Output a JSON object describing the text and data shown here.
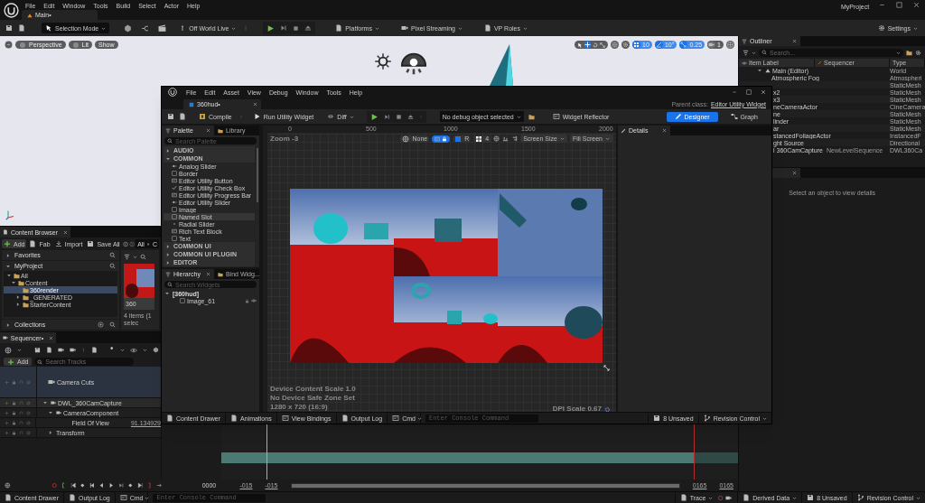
{
  "app_menu": [
    "File",
    "Edit",
    "Window",
    "Tools",
    "Build",
    "Select",
    "Actor",
    "Help"
  ],
  "level_tab": "Main•",
  "project_name": "MyProject",
  "toolbar": {
    "mode": "Selection Mode",
    "world": "Off World Live",
    "platforms": "Platforms",
    "pixel_streaming": "Pixel Streaming",
    "vp_roles": "VP Roles",
    "settings": "Settings"
  },
  "viewport": {
    "pills": [
      "Perspective",
      "Lit",
      "Show"
    ],
    "snap": [
      "10",
      "10°",
      "0.25",
      "1"
    ]
  },
  "outliner": {
    "title": "Outliner",
    "search_placeholder": "Search...",
    "columns": [
      "Item Label",
      "Sequencer",
      "Type"
    ],
    "tree": [
      {
        "label": "Main (Editor)",
        "type": "World",
        "expanded": true,
        "children": [
          {
            "kind": "full",
            "label": "Atmospheric Fog",
            "type": "Atmospheri"
          },
          {
            "kind": "clipped",
            "type": "StaticMesh"
          },
          {
            "kind": "clipped",
            "label": "x2",
            "type": "StaticMesh"
          },
          {
            "kind": "clipped",
            "label": "x3",
            "type": "StaticMesh"
          },
          {
            "kind": "clipped",
            "label": "neCameraActor",
            "type": "CineCamera"
          },
          {
            "kind": "clipped",
            "label": "ne",
            "type": "StaticMesh"
          },
          {
            "kind": "clipped",
            "label": "linder",
            "type": "StaticMesh"
          },
          {
            "kind": "clipped",
            "label": "ar",
            "type": "StaticMesh"
          },
          {
            "kind": "clipped",
            "label": "stancedFoliageActor",
            "type": "InstancedF"
          },
          {
            "kind": "clipped",
            "label": "ght Source",
            "type": "Directional"
          },
          {
            "kind": "clipped",
            "label": "l 360CamCapture",
            "sequencer": "NewLevelSequence",
            "type": "DWL360Ca"
          }
        ]
      }
    ]
  },
  "details_main": {
    "message": "Select an object to view details"
  },
  "content_browser": {
    "title": "Content Browser",
    "buttons": [
      "Add",
      "Fab",
      "Import",
      "Save All"
    ],
    "path": [
      "All",
      "C"
    ],
    "sections": [
      {
        "label": "Favorites",
        "expanded": false
      },
      {
        "label": "MyProject",
        "expanded": true
      },
      {
        "label": "Collections",
        "expanded": false
      }
    ],
    "tree": [
      {
        "label": "All",
        "expanded": true,
        "selected": false,
        "children": [
          {
            "label": "Content",
            "expanded": true,
            "selected": false,
            "children": [
              {
                "label": "360render",
                "selected": true
              },
              {
                "label": "_GENERATED",
                "expanded": false,
                "selected": false
              },
              {
                "label": "StarterContent",
                "expanded": false,
                "selected": false
              }
            ]
          }
        ]
      }
    ],
    "asset": "360",
    "count": "4 items (1 selec"
  },
  "sequencer": {
    "title": "Sequencer•",
    "add": "Add",
    "search_placeholder": "Search Tracks",
    "tracks": [
      {
        "kind": "cuts",
        "label": "Camera Cuts"
      },
      {
        "kind": "actor",
        "label": "DWL_360CamCapture",
        "expanded": true,
        "children": [
          {
            "kind": "component",
            "label": "CameraComponent",
            "expanded": true,
            "children": [
              {
                "kind": "property",
                "label": "Field Of View",
                "value": "91.134929"
              }
            ]
          },
          {
            "kind": "property",
            "label": "Transform",
            "expanded": false
          }
        ]
      }
    ],
    "time": "0000",
    "range_start": [
      "-015",
      "-015"
    ],
    "range_end": [
      "0165",
      "0165"
    ]
  },
  "status_bar": {
    "left": [
      "Content Drawer",
      "Output Log",
      "Cmd"
    ],
    "console_placeholder": "Enter Console Command",
    "right": [
      "Trace",
      "Derived Data",
      "8 Unsaved",
      "Revision Control"
    ]
  },
  "widget_editor": {
    "menu": [
      "File",
      "Edit",
      "Asset",
      "View",
      "Debug",
      "Window",
      "Tools",
      "Help"
    ],
    "tab": "360hud•",
    "parent_class_label": "Parent class:",
    "parent_class": "Editor Utility Widget",
    "toolbar": {
      "compile": "Compile",
      "run": "Run Utility Widget",
      "diff": "Diff",
      "debug": "No debug object selected",
      "reflector": "Widget Reflector"
    },
    "modes": [
      {
        "label": "Designer",
        "selected": true
      },
      {
        "label": "Graph",
        "selected": false
      }
    ],
    "palette": {
      "tabs": [
        {
          "label": "Palette",
          "selected": true
        },
        {
          "label": "Library",
          "selected": false
        }
      ],
      "search_placeholder": "Search Palette",
      "categories": [
        {
          "label": "AUDIO",
          "expanded": false
        },
        {
          "label": "COMMON",
          "expanded": true,
          "children": [
            {
              "label": "Analog Slider",
              "selected": false
            },
            {
              "label": "Border",
              "selected": false
            },
            {
              "label": "Editor Utility Button",
              "selected": false
            },
            {
              "label": "Editor Utility Check Box",
              "selected": false
            },
            {
              "label": "Editor Utility Progress Bar",
              "selected": false
            },
            {
              "label": "Editor Utility Slider",
              "selected": false
            },
            {
              "label": "Image",
              "selected": false
            },
            {
              "label": "Named Slot",
              "selected": true
            },
            {
              "label": "Radial Slider",
              "selected": false
            },
            {
              "label": "Rich Text Block",
              "selected": false
            },
            {
              "label": "Text",
              "selected": false
            }
          ]
        },
        {
          "label": "COMMON UI",
          "expanded": false
        },
        {
          "label": "COMMON UI PLUGIN",
          "expanded": false
        },
        {
          "label": "EDITOR",
          "expanded": false
        }
      ]
    },
    "hierarchy": {
      "tabs": [
        {
          "label": "Hierarchy",
          "selected": true
        },
        {
          "label": "Bind Widg...",
          "selected": false
        }
      ],
      "search_placeholder": "Search Widgets",
      "tree": [
        {
          "label": "[360hud]",
          "expanded": true,
          "children": [
            {
              "label": "Image_61"
            }
          ]
        }
      ]
    },
    "canvas": {
      "zoom": "Zoom -3",
      "snap_lock_on": true,
      "ruler": [
        "0",
        "500",
        "1000",
        "1500",
        "2000"
      ],
      "toolbar": [
        "None",
        "R",
        "4",
        "Screen Size",
        "Fill Screen"
      ],
      "info": [
        "Device Content Scale 1.0",
        "No Device Safe Zone Set",
        "1280 x 720 (16:9)"
      ],
      "dpi": "DPI Scale 0.67"
    },
    "details": {
      "title": "Details"
    },
    "bottom_bar": {
      "left": [
        "Content Drawer",
        "Animations",
        "View Bindings",
        "Output Log",
        "Cmd"
      ],
      "console_placeholder": "Enter Console Command",
      "right": [
        "8 Unsaved",
        "Revision Control"
      ]
    }
  }
}
